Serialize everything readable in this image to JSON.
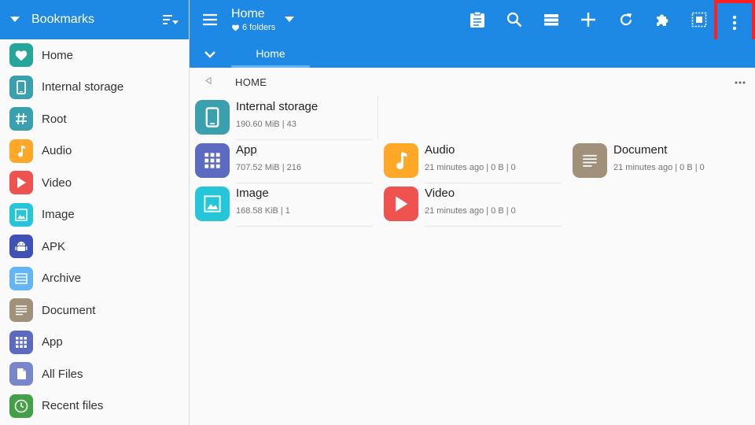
{
  "sidebar": {
    "title": "Bookmarks",
    "items": [
      {
        "label": "Home",
        "icon": "heart-icon",
        "color": "#26a69a"
      },
      {
        "label": "Internal storage",
        "icon": "phone-icon",
        "color": "#3ba0ad"
      },
      {
        "label": "Root",
        "icon": "hash-icon",
        "color": "#3ba0ad"
      },
      {
        "label": "Audio",
        "icon": "music-note-icon",
        "color": "#ffa726"
      },
      {
        "label": "Video",
        "icon": "play-icon",
        "color": "#ef5350"
      },
      {
        "label": "Image",
        "icon": "image-icon",
        "color": "#26c6da"
      },
      {
        "label": "APK",
        "icon": "android-icon",
        "color": "#3f51b5"
      },
      {
        "label": "Archive",
        "icon": "archive-icon",
        "color": "#64b5f6"
      },
      {
        "label": "Document",
        "icon": "document-icon",
        "color": "#a1917a"
      },
      {
        "label": "App",
        "icon": "grid-icon",
        "color": "#5c6bc0"
      },
      {
        "label": "All Files",
        "icon": "file-icon",
        "color": "#7986cb"
      },
      {
        "label": "Recent files",
        "icon": "clock-icon",
        "color": "#43a047"
      }
    ]
  },
  "topbar": {
    "title": "Home",
    "subtitle": "6 folders",
    "actions": [
      "clipboard-icon",
      "search-icon",
      "list-view-icon",
      "add-icon",
      "refresh-icon",
      "extension-icon",
      "select-all-icon",
      "more-vert-icon"
    ]
  },
  "tabs": {
    "active": "Home"
  },
  "path": {
    "label": "HOME"
  },
  "folders": [
    {
      "name": "Internal storage",
      "meta": "190.60 MiB | 43",
      "icon": "phone-icon",
      "color": "#3ba0ad"
    },
    {
      "name": "App",
      "meta": "707.52 MiB | 216",
      "icon": "grid-icon",
      "color": "#5c6bc0"
    },
    {
      "name": "Audio",
      "meta": "21 minutes ago | 0 B | 0",
      "icon": "music-note-icon",
      "color": "#ffa726"
    },
    {
      "name": "Document",
      "meta": "21 minutes ago | 0 B | 0",
      "icon": "document-icon",
      "color": "#a1917a"
    },
    {
      "name": "Image",
      "meta": "168.58  KiB | 1",
      "icon": "image-icon",
      "color": "#26c6da"
    },
    {
      "name": "Video",
      "meta": "21 minutes ago | 0 B | 0",
      "icon": "play-icon",
      "color": "#ef5350"
    }
  ]
}
